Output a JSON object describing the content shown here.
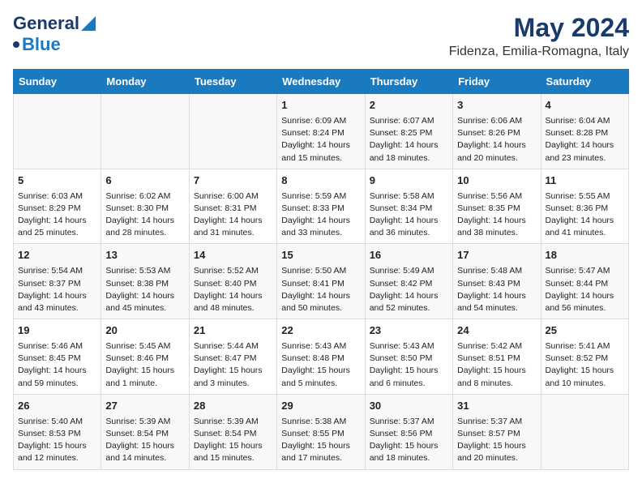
{
  "header": {
    "logo_line1": "General",
    "logo_line2": "Blue",
    "title": "May 2024",
    "subtitle": "Fidenza, Emilia-Romagna, Italy"
  },
  "days_of_week": [
    "Sunday",
    "Monday",
    "Tuesday",
    "Wednesday",
    "Thursday",
    "Friday",
    "Saturday"
  ],
  "weeks": [
    [
      {
        "day": "",
        "content": ""
      },
      {
        "day": "",
        "content": ""
      },
      {
        "day": "",
        "content": ""
      },
      {
        "day": "1",
        "content": "Sunrise: 6:09 AM\nSunset: 8:24 PM\nDaylight: 14 hours\nand 15 minutes."
      },
      {
        "day": "2",
        "content": "Sunrise: 6:07 AM\nSunset: 8:25 PM\nDaylight: 14 hours\nand 18 minutes."
      },
      {
        "day": "3",
        "content": "Sunrise: 6:06 AM\nSunset: 8:26 PM\nDaylight: 14 hours\nand 20 minutes."
      },
      {
        "day": "4",
        "content": "Sunrise: 6:04 AM\nSunset: 8:28 PM\nDaylight: 14 hours\nand 23 minutes."
      }
    ],
    [
      {
        "day": "5",
        "content": "Sunrise: 6:03 AM\nSunset: 8:29 PM\nDaylight: 14 hours\nand 25 minutes."
      },
      {
        "day": "6",
        "content": "Sunrise: 6:02 AM\nSunset: 8:30 PM\nDaylight: 14 hours\nand 28 minutes."
      },
      {
        "day": "7",
        "content": "Sunrise: 6:00 AM\nSunset: 8:31 PM\nDaylight: 14 hours\nand 31 minutes."
      },
      {
        "day": "8",
        "content": "Sunrise: 5:59 AM\nSunset: 8:33 PM\nDaylight: 14 hours\nand 33 minutes."
      },
      {
        "day": "9",
        "content": "Sunrise: 5:58 AM\nSunset: 8:34 PM\nDaylight: 14 hours\nand 36 minutes."
      },
      {
        "day": "10",
        "content": "Sunrise: 5:56 AM\nSunset: 8:35 PM\nDaylight: 14 hours\nand 38 minutes."
      },
      {
        "day": "11",
        "content": "Sunrise: 5:55 AM\nSunset: 8:36 PM\nDaylight: 14 hours\nand 41 minutes."
      }
    ],
    [
      {
        "day": "12",
        "content": "Sunrise: 5:54 AM\nSunset: 8:37 PM\nDaylight: 14 hours\nand 43 minutes."
      },
      {
        "day": "13",
        "content": "Sunrise: 5:53 AM\nSunset: 8:38 PM\nDaylight: 14 hours\nand 45 minutes."
      },
      {
        "day": "14",
        "content": "Sunrise: 5:52 AM\nSunset: 8:40 PM\nDaylight: 14 hours\nand 48 minutes."
      },
      {
        "day": "15",
        "content": "Sunrise: 5:50 AM\nSunset: 8:41 PM\nDaylight: 14 hours\nand 50 minutes."
      },
      {
        "day": "16",
        "content": "Sunrise: 5:49 AM\nSunset: 8:42 PM\nDaylight: 14 hours\nand 52 minutes."
      },
      {
        "day": "17",
        "content": "Sunrise: 5:48 AM\nSunset: 8:43 PM\nDaylight: 14 hours\nand 54 minutes."
      },
      {
        "day": "18",
        "content": "Sunrise: 5:47 AM\nSunset: 8:44 PM\nDaylight: 14 hours\nand 56 minutes."
      }
    ],
    [
      {
        "day": "19",
        "content": "Sunrise: 5:46 AM\nSunset: 8:45 PM\nDaylight: 14 hours\nand 59 minutes."
      },
      {
        "day": "20",
        "content": "Sunrise: 5:45 AM\nSunset: 8:46 PM\nDaylight: 15 hours\nand 1 minute."
      },
      {
        "day": "21",
        "content": "Sunrise: 5:44 AM\nSunset: 8:47 PM\nDaylight: 15 hours\nand 3 minutes."
      },
      {
        "day": "22",
        "content": "Sunrise: 5:43 AM\nSunset: 8:48 PM\nDaylight: 15 hours\nand 5 minutes."
      },
      {
        "day": "23",
        "content": "Sunrise: 5:43 AM\nSunset: 8:50 PM\nDaylight: 15 hours\nand 6 minutes."
      },
      {
        "day": "24",
        "content": "Sunrise: 5:42 AM\nSunset: 8:51 PM\nDaylight: 15 hours\nand 8 minutes."
      },
      {
        "day": "25",
        "content": "Sunrise: 5:41 AM\nSunset: 8:52 PM\nDaylight: 15 hours\nand 10 minutes."
      }
    ],
    [
      {
        "day": "26",
        "content": "Sunrise: 5:40 AM\nSunset: 8:53 PM\nDaylight: 15 hours\nand 12 minutes."
      },
      {
        "day": "27",
        "content": "Sunrise: 5:39 AM\nSunset: 8:54 PM\nDaylight: 15 hours\nand 14 minutes."
      },
      {
        "day": "28",
        "content": "Sunrise: 5:39 AM\nSunset: 8:54 PM\nDaylight: 15 hours\nand 15 minutes."
      },
      {
        "day": "29",
        "content": "Sunrise: 5:38 AM\nSunset: 8:55 PM\nDaylight: 15 hours\nand 17 minutes."
      },
      {
        "day": "30",
        "content": "Sunrise: 5:37 AM\nSunset: 8:56 PM\nDaylight: 15 hours\nand 18 minutes."
      },
      {
        "day": "31",
        "content": "Sunrise: 5:37 AM\nSunset: 8:57 PM\nDaylight: 15 hours\nand 20 minutes."
      },
      {
        "day": "",
        "content": ""
      }
    ]
  ]
}
